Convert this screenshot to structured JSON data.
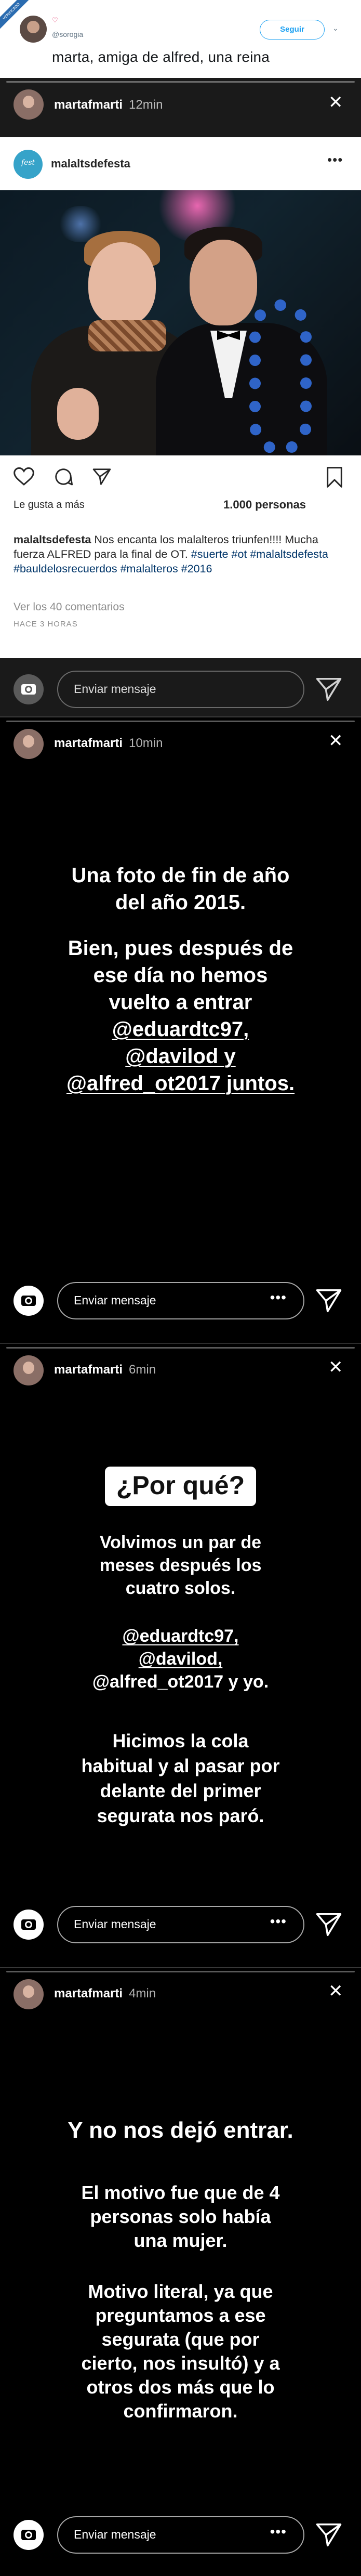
{
  "tweet": {
    "handle": "@sorogia",
    "follow_label": "Seguir",
    "text": "marta, amiga de alfred, una reina",
    "ribbon_text": "VERIFICADO"
  },
  "stories": [
    {
      "username": "martafmarti",
      "time": "12min",
      "reply_placeholder": "Enviar mensaje",
      "post": {
        "username": "malaltsdefesta",
        "likes_label": "Le gusta a más",
        "likes_count": "1.000 personas",
        "caption_user": "malaltsdefesta",
        "caption_text": " Nos encanta los malalteros triunfen!!!! Mucha fuerza ALFRED para la final de OT.",
        "caption_tags": "#suerte #ot #malaltsdefesta #bauldelosrecuerdos #malalteros #2016",
        "comments_link": "Ver los 40 comentarios",
        "time_ago": "HACE 3 HORAS"
      }
    },
    {
      "username": "martafmarti",
      "time": "10min",
      "reply_placeholder": "Enviar mensaje",
      "lines": [
        "Una foto de fin de año",
        "del año 2015.",
        "",
        "Bien, pues después de",
        "ese día no hemos",
        "vuelto a entrar",
        "@eduardtc97,",
        "@davilod y",
        "@alfred_ot2017 juntos."
      ]
    },
    {
      "username": "martafmarti",
      "time": "6min",
      "reply_placeholder": "Enviar mensaje",
      "title": "¿Por qué?",
      "para1": [
        "Volvimos un par de",
        "meses después los",
        "cuatro solos."
      ],
      "para2": [
        "@eduardtc97,",
        "@davilod,",
        "@alfred_ot2017 y yo."
      ],
      "para3": [
        "Hicimos la cola",
        "habitual y al pasar por",
        "delante del primer",
        "segurata nos paró."
      ]
    },
    {
      "username": "martafmarti",
      "time": "4min",
      "reply_placeholder": "Enviar mensaje",
      "headline": "Y no nos dejó entrar.",
      "para1": [
        "El motivo fue que de 4",
        "personas solo había",
        "una mujer."
      ],
      "para2": [
        "Motivo literal, ya que",
        "preguntamos a ese",
        "segurata (que por",
        "cierto, nos insultó) y a",
        "otros dos más que lo",
        "confirmaron."
      ]
    }
  ]
}
